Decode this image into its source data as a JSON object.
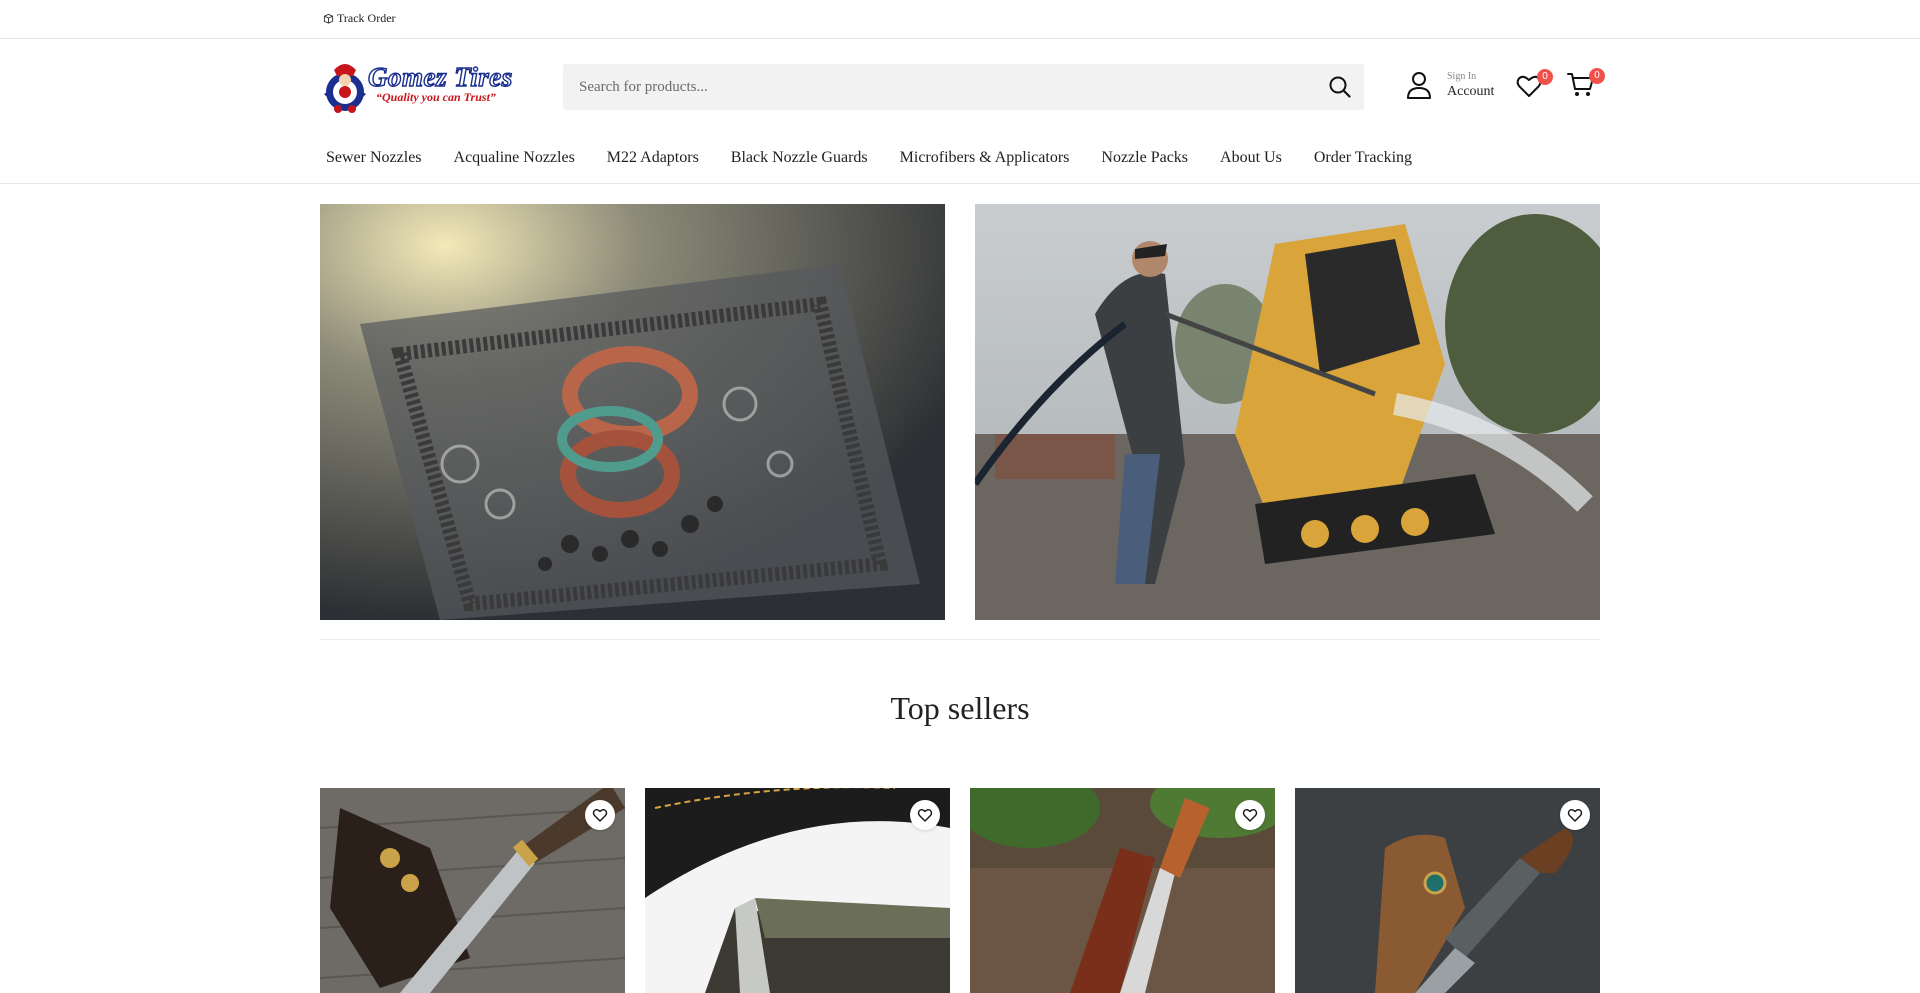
{
  "topbar": {
    "track_order": "Track Order"
  },
  "header": {
    "logo": {
      "name": "Gomez Tires",
      "slogan": "“Quality you can Trust”"
    },
    "search": {
      "placeholder": "Search for products..."
    },
    "account": {
      "small": "Sign In",
      "label": "Account"
    },
    "wishlist": {
      "count": "0"
    },
    "cart": {
      "count": "0"
    }
  },
  "nav": {
    "items": [
      {
        "label": "Sewer Nozzles"
      },
      {
        "label": "Acqualine Nozzles"
      },
      {
        "label": "M22 Adaptors"
      },
      {
        "label": "Black Nozzle Guards"
      },
      {
        "label": "Microfibers & Applicators"
      },
      {
        "label": "Nozzle Packs"
      },
      {
        "label": "About Us"
      },
      {
        "label": "Order Tracking"
      }
    ]
  },
  "sections": {
    "top_sellers": "Top sellers"
  },
  "colors": {
    "badge": "#f0524a",
    "logo_blue": "#1b2f8f",
    "logo_red": "#c8141b",
    "search_bg": "#f2f2f2"
  },
  "icons": {
    "track": "package-icon",
    "search": "search-icon",
    "account": "user-icon",
    "wishlist": "heart-icon",
    "cart": "cart-icon"
  }
}
